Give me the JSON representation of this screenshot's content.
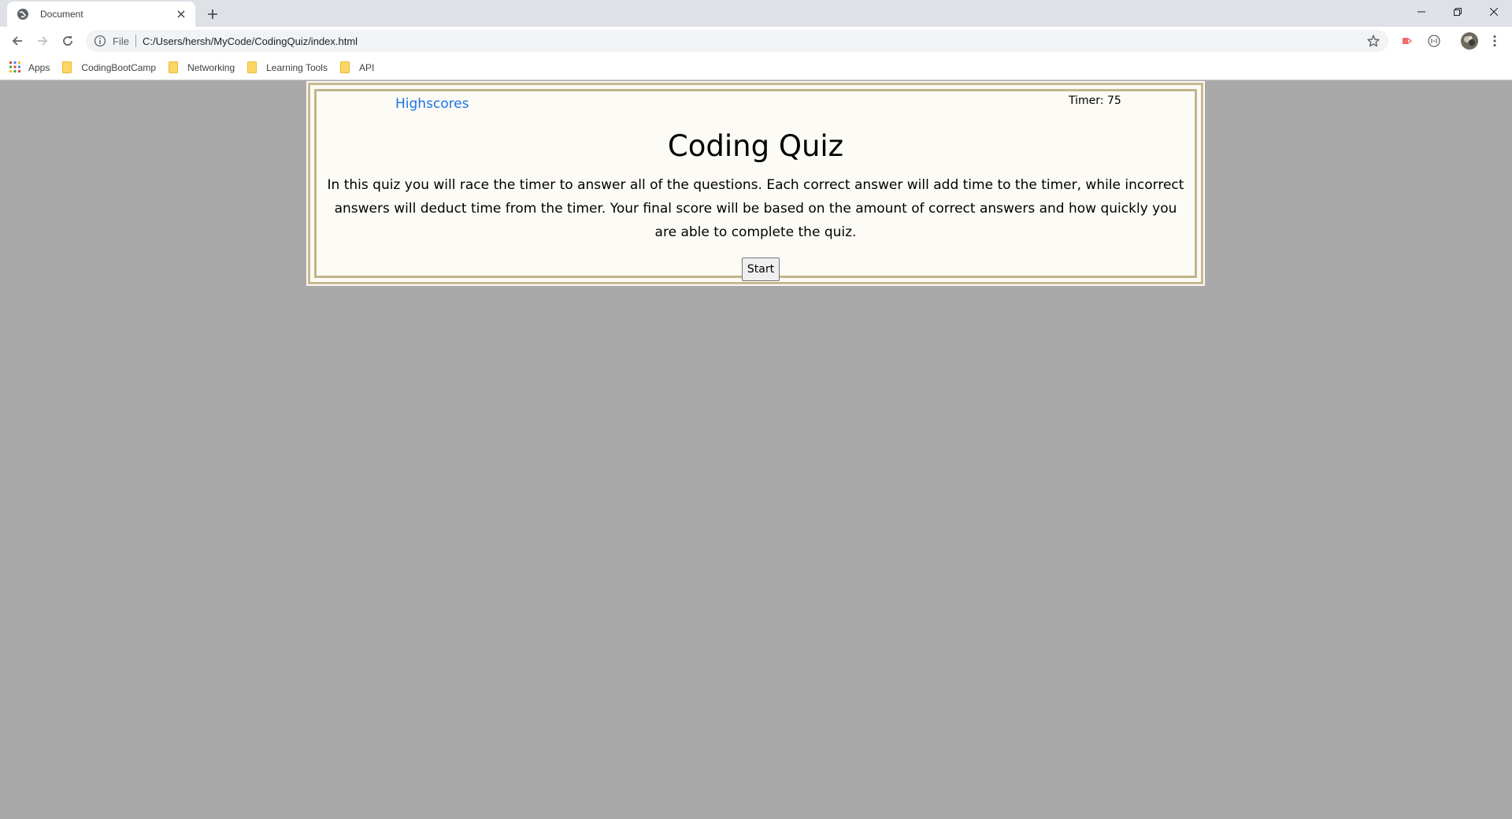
{
  "browser": {
    "tab": {
      "title": "Document",
      "favicon": "globe-icon",
      "close_icon": "close-icon"
    },
    "new_tab_icon": "plus-icon",
    "window_controls": [
      "minimize-icon",
      "restore-icon",
      "close-icon"
    ],
    "omnibox": {
      "scheme_label": "File",
      "url": "C:/Users/hersh/MyCode/CodingQuiz/index.html"
    },
    "bookmarks": [
      {
        "label": "Apps",
        "icon": "apps-grid-icon"
      },
      {
        "label": "CodingBootCamp",
        "icon": "folder-icon"
      },
      {
        "label": "Networking",
        "icon": "folder-icon"
      },
      {
        "label": "Learning Tools",
        "icon": "folder-icon"
      },
      {
        "label": "API",
        "icon": "folder-icon"
      }
    ]
  },
  "page": {
    "highscores_link": "Highscores",
    "timer": "Timer: 75",
    "title": "Coding Quiz",
    "description": "In this quiz you will race the timer to answer all of the questions. Each correct answer will add time to the timer, while incorrect answers will deduct time from the timer. Your final score will be based on the amount of correct answers and how quickly you are able to complete the quiz.",
    "start_button": "Start"
  },
  "colors": {
    "page_background": "#a9a9a9",
    "card_background": "#fdfbf6",
    "card_border": "#c8b88f",
    "link": "#1a73e8"
  }
}
